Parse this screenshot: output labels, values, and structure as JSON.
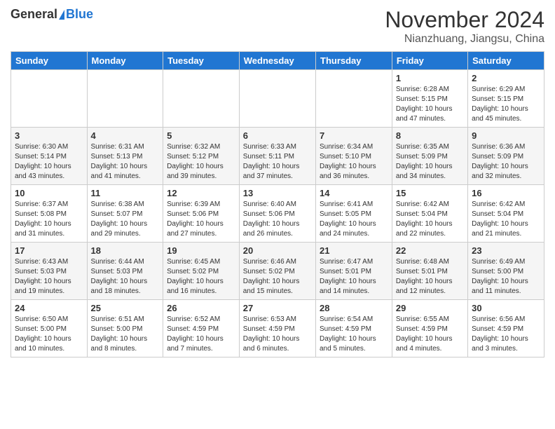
{
  "logo": {
    "general": "General",
    "blue": "Blue"
  },
  "header": {
    "month": "November 2024",
    "location": "Nianzhuang, Jiangsu, China"
  },
  "days_of_week": [
    "Sunday",
    "Monday",
    "Tuesday",
    "Wednesday",
    "Thursday",
    "Friday",
    "Saturday"
  ],
  "weeks": [
    [
      {
        "day": "",
        "info": ""
      },
      {
        "day": "",
        "info": ""
      },
      {
        "day": "",
        "info": ""
      },
      {
        "day": "",
        "info": ""
      },
      {
        "day": "",
        "info": ""
      },
      {
        "day": "1",
        "info": "Sunrise: 6:28 AM\nSunset: 5:15 PM\nDaylight: 10 hours and 47 minutes."
      },
      {
        "day": "2",
        "info": "Sunrise: 6:29 AM\nSunset: 5:15 PM\nDaylight: 10 hours and 45 minutes."
      }
    ],
    [
      {
        "day": "3",
        "info": "Sunrise: 6:30 AM\nSunset: 5:14 PM\nDaylight: 10 hours and 43 minutes."
      },
      {
        "day": "4",
        "info": "Sunrise: 6:31 AM\nSunset: 5:13 PM\nDaylight: 10 hours and 41 minutes."
      },
      {
        "day": "5",
        "info": "Sunrise: 6:32 AM\nSunset: 5:12 PM\nDaylight: 10 hours and 39 minutes."
      },
      {
        "day": "6",
        "info": "Sunrise: 6:33 AM\nSunset: 5:11 PM\nDaylight: 10 hours and 37 minutes."
      },
      {
        "day": "7",
        "info": "Sunrise: 6:34 AM\nSunset: 5:10 PM\nDaylight: 10 hours and 36 minutes."
      },
      {
        "day": "8",
        "info": "Sunrise: 6:35 AM\nSunset: 5:09 PM\nDaylight: 10 hours and 34 minutes."
      },
      {
        "day": "9",
        "info": "Sunrise: 6:36 AM\nSunset: 5:09 PM\nDaylight: 10 hours and 32 minutes."
      }
    ],
    [
      {
        "day": "10",
        "info": "Sunrise: 6:37 AM\nSunset: 5:08 PM\nDaylight: 10 hours and 31 minutes."
      },
      {
        "day": "11",
        "info": "Sunrise: 6:38 AM\nSunset: 5:07 PM\nDaylight: 10 hours and 29 minutes."
      },
      {
        "day": "12",
        "info": "Sunrise: 6:39 AM\nSunset: 5:06 PM\nDaylight: 10 hours and 27 minutes."
      },
      {
        "day": "13",
        "info": "Sunrise: 6:40 AM\nSunset: 5:06 PM\nDaylight: 10 hours and 26 minutes."
      },
      {
        "day": "14",
        "info": "Sunrise: 6:41 AM\nSunset: 5:05 PM\nDaylight: 10 hours and 24 minutes."
      },
      {
        "day": "15",
        "info": "Sunrise: 6:42 AM\nSunset: 5:04 PM\nDaylight: 10 hours and 22 minutes."
      },
      {
        "day": "16",
        "info": "Sunrise: 6:42 AM\nSunset: 5:04 PM\nDaylight: 10 hours and 21 minutes."
      }
    ],
    [
      {
        "day": "17",
        "info": "Sunrise: 6:43 AM\nSunset: 5:03 PM\nDaylight: 10 hours and 19 minutes."
      },
      {
        "day": "18",
        "info": "Sunrise: 6:44 AM\nSunset: 5:03 PM\nDaylight: 10 hours and 18 minutes."
      },
      {
        "day": "19",
        "info": "Sunrise: 6:45 AM\nSunset: 5:02 PM\nDaylight: 10 hours and 16 minutes."
      },
      {
        "day": "20",
        "info": "Sunrise: 6:46 AM\nSunset: 5:02 PM\nDaylight: 10 hours and 15 minutes."
      },
      {
        "day": "21",
        "info": "Sunrise: 6:47 AM\nSunset: 5:01 PM\nDaylight: 10 hours and 14 minutes."
      },
      {
        "day": "22",
        "info": "Sunrise: 6:48 AM\nSunset: 5:01 PM\nDaylight: 10 hours and 12 minutes."
      },
      {
        "day": "23",
        "info": "Sunrise: 6:49 AM\nSunset: 5:00 PM\nDaylight: 10 hours and 11 minutes."
      }
    ],
    [
      {
        "day": "24",
        "info": "Sunrise: 6:50 AM\nSunset: 5:00 PM\nDaylight: 10 hours and 10 minutes."
      },
      {
        "day": "25",
        "info": "Sunrise: 6:51 AM\nSunset: 5:00 PM\nDaylight: 10 hours and 8 minutes."
      },
      {
        "day": "26",
        "info": "Sunrise: 6:52 AM\nSunset: 4:59 PM\nDaylight: 10 hours and 7 minutes."
      },
      {
        "day": "27",
        "info": "Sunrise: 6:53 AM\nSunset: 4:59 PM\nDaylight: 10 hours and 6 minutes."
      },
      {
        "day": "28",
        "info": "Sunrise: 6:54 AM\nSunset: 4:59 PM\nDaylight: 10 hours and 5 minutes."
      },
      {
        "day": "29",
        "info": "Sunrise: 6:55 AM\nSunset: 4:59 PM\nDaylight: 10 hours and 4 minutes."
      },
      {
        "day": "30",
        "info": "Sunrise: 6:56 AM\nSunset: 4:59 PM\nDaylight: 10 hours and 3 minutes."
      }
    ]
  ]
}
